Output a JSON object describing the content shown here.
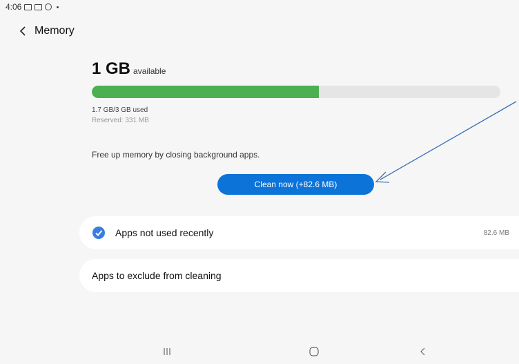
{
  "status_bar": {
    "time": "4:06",
    "dot": "•"
  },
  "header": {
    "title": "Memory"
  },
  "memory": {
    "available_value": "1 GB",
    "available_unit": "available",
    "used_fraction": 0.555,
    "used_text": "1.7 GB/3 GB used",
    "reserved_text": "Reserved: 331 MB",
    "tip": "Free up memory by closing background apps.",
    "bar_fill_color": "#4caf50",
    "bar_track_color": "#e5e5e5"
  },
  "clean_button": {
    "label": "Clean now (+82.6 MB)",
    "color": "#0c74d9"
  },
  "cards": [
    {
      "label": "Apps not used recently",
      "size": "82.6 MB",
      "checked": true
    },
    {
      "label": "Apps to exclude from cleaning"
    }
  ],
  "nav": [
    "recent-apps",
    "home",
    "back"
  ],
  "icons": [
    "back-arrow-icon",
    "check-circle-icon",
    "recent-apps-icon",
    "home-icon",
    "back-icon",
    "image-icon",
    "gallery-icon",
    "drive-icon"
  ]
}
